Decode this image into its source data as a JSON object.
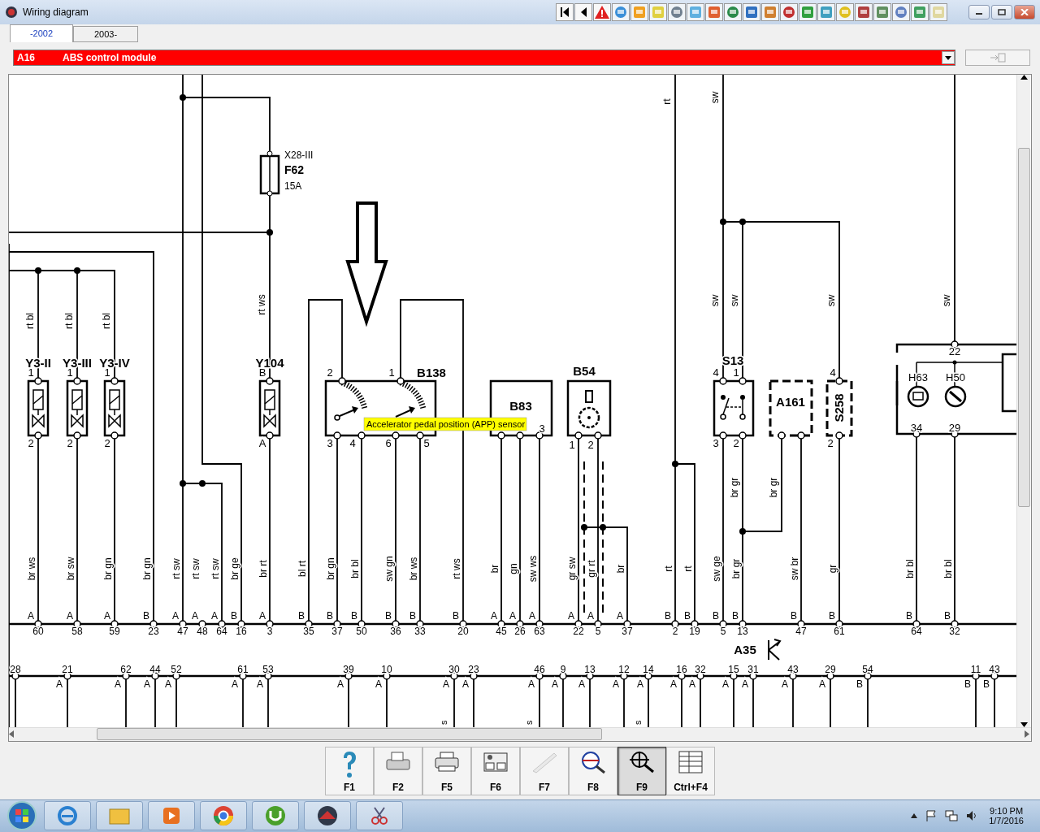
{
  "window": {
    "title": "Wiring diagram"
  },
  "tabs": [
    {
      "label": "-2002",
      "selected": true
    },
    {
      "label": "2003-",
      "selected": false
    }
  ],
  "module_select": {
    "code": "A16",
    "name": "ABS control module"
  },
  "diagram": {
    "fuse": {
      "connector": "X28-III",
      "name": "F62",
      "rating": "15A"
    },
    "components": [
      {
        "kind": "valve",
        "name": "Y3-II",
        "pins": [
          "1",
          "2"
        ]
      },
      {
        "kind": "valve",
        "name": "Y3-III",
        "pins": [
          "1",
          "2"
        ]
      },
      {
        "kind": "valve",
        "name": "Y3-IV",
        "pins": [
          "1",
          "2"
        ]
      },
      {
        "kind": "valve",
        "name": "Y104",
        "pins": [
          "B",
          "A"
        ]
      },
      {
        "kind": "pedal_sensor",
        "name": "B138",
        "pins": [
          "2",
          "1",
          "3",
          "4",
          "6",
          "5"
        ]
      },
      {
        "kind": "sensor",
        "name": "B83",
        "pins": [
          "3"
        ]
      },
      {
        "kind": "speed_sensor",
        "name": "B54",
        "pins": [
          "1",
          "2"
        ]
      },
      {
        "kind": "switch",
        "name": "S13",
        "pins": [
          "4",
          "1",
          "3",
          "2"
        ]
      },
      {
        "kind": "module",
        "name": "A161"
      },
      {
        "kind": "switch_vertical",
        "name": "S258",
        "pins": [
          "4",
          "2"
        ]
      },
      {
        "kind": "lamp_module",
        "lamps": [
          "H63",
          "H50"
        ],
        "pins": [
          "22",
          "34",
          "29"
        ]
      }
    ],
    "upper_wire_labels": [
      "rt bl",
      "rt bl",
      "rt bl",
      "rt ws",
      "rt",
      "sw",
      "sw",
      "sw",
      "sw",
      "sw",
      "br gr",
      "br gr"
    ],
    "connector_1": [
      {
        "letter": "A",
        "number": "60",
        "wire": "br ws"
      },
      {
        "letter": "A",
        "number": "58",
        "wire": "br sw"
      },
      {
        "letter": "A",
        "number": "59",
        "wire": "br gn"
      },
      {
        "letter": "B",
        "number": "23",
        "wire": "br gn"
      },
      {
        "letter": "A",
        "number": "47",
        "wire": "rt sw"
      },
      {
        "letter": "A",
        "number": "48",
        "wire": "rt sw"
      },
      {
        "letter": "A",
        "number": "64",
        "wire": "rt sw"
      },
      {
        "letter": "B",
        "number": "16",
        "wire": "br ge"
      },
      {
        "letter": "A",
        "number": "3",
        "wire": "br rt"
      },
      {
        "letter": "B",
        "number": "35",
        "wire": "bl rt"
      },
      {
        "letter": "B",
        "number": "37",
        "wire": "br gn"
      },
      {
        "letter": "B",
        "number": "50",
        "wire": "br bl"
      },
      {
        "letter": "B",
        "number": "36",
        "wire": "sw gn"
      },
      {
        "letter": "B",
        "number": "33",
        "wire": "br ws"
      },
      {
        "letter": "B",
        "number": "20",
        "wire": "rt ws"
      },
      {
        "letter": "A",
        "number": "45",
        "wire": "br"
      },
      {
        "letter": "A",
        "number": "26",
        "wire": "gn"
      },
      {
        "letter": "A",
        "number": "63",
        "wire": "sw ws"
      },
      {
        "letter": "A",
        "number": "22",
        "wire": "gr sw"
      },
      {
        "letter": "A",
        "number": "5",
        "wire": "gr rt"
      },
      {
        "letter": "A",
        "number": "37",
        "wire": "br"
      },
      {
        "letter": "B",
        "number": "2",
        "wire": "rt"
      },
      {
        "letter": "B",
        "number": "19",
        "wire": "rt"
      },
      {
        "letter": "B",
        "number": "5",
        "wire": "sw ge"
      },
      {
        "letter": "B",
        "number": "13",
        "wire": "br gr"
      },
      {
        "letter": "B",
        "number": "47",
        "wire": "sw br"
      },
      {
        "letter": "B",
        "number": "61",
        "wire": "gr"
      },
      {
        "letter": "B",
        "number": "64",
        "wire": "br bl"
      },
      {
        "letter": "B",
        "number": "32",
        "wire": "br bl"
      }
    ],
    "ground": {
      "name": "A35"
    },
    "connector_2": [
      {
        "number": "28"
      },
      {
        "letter": "A",
        "number": "21"
      },
      {
        "letter": "A",
        "number": "62"
      },
      {
        "letter": "A",
        "number": "44"
      },
      {
        "letter": "A",
        "number": "52"
      },
      {
        "letter": "A",
        "number": "61"
      },
      {
        "letter": "A",
        "number": "53"
      },
      {
        "letter": "A",
        "number": "39"
      },
      {
        "letter": "A",
        "number": "10"
      },
      {
        "letter": "A",
        "number": "30",
        "wire": "s"
      },
      {
        "letter": "A",
        "number": "23"
      },
      {
        "letter": "A",
        "number": "46",
        "wire": "s"
      },
      {
        "letter": "A",
        "number": "9"
      },
      {
        "letter": "A",
        "number": "13"
      },
      {
        "letter": "A",
        "number": "12"
      },
      {
        "letter": "A",
        "number": "14",
        "wire": "s"
      },
      {
        "letter": "A",
        "number": "16"
      },
      {
        "letter": "A",
        "number": "32"
      },
      {
        "letter": "A",
        "number": "15"
      },
      {
        "letter": "A",
        "number": "31"
      },
      {
        "letter": "A",
        "number": "43"
      },
      {
        "letter": "A",
        "number": "29"
      },
      {
        "letter": "B",
        "number": "54"
      },
      {
        "letter": "B",
        "number": "11"
      },
      {
        "letter": "B",
        "number": "43"
      }
    ],
    "tooltip": "Accelerator pedal position (APP) sensor"
  },
  "function_keys": [
    {
      "label": "F1",
      "selected": false,
      "disabled": false
    },
    {
      "label": "F2",
      "selected": false,
      "disabled": false
    },
    {
      "label": "F5",
      "selected": false,
      "disabled": false
    },
    {
      "label": "F6",
      "selected": false,
      "disabled": false
    },
    {
      "label": "F7",
      "selected": false,
      "disabled": true
    },
    {
      "label": "F8",
      "selected": false,
      "disabled": false
    },
    {
      "label": "F9",
      "selected": true,
      "disabled": false
    },
    {
      "label": "Ctrl+F4",
      "selected": false,
      "disabled": false
    }
  ],
  "taskbar": {
    "time": "9:10 PM",
    "date": "1/7/2016"
  }
}
